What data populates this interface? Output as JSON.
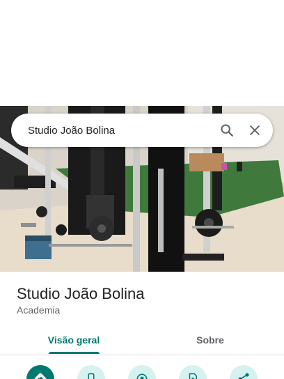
{
  "search": {
    "query": "Studio João Bolina"
  },
  "place": {
    "name": "Studio João Bolina",
    "category": "Academia"
  },
  "tabs": [
    {
      "label": "Visão geral",
      "selected": true
    },
    {
      "label": "Sobre",
      "selected": false
    }
  ],
  "actions": [
    {
      "icon": "directions-icon"
    },
    {
      "icon": "phone-icon"
    },
    {
      "icon": "location-icon"
    },
    {
      "icon": "save-icon"
    },
    {
      "icon": "share-icon"
    }
  ],
  "colors": {
    "accent": "#01796f",
    "accent_light": "#d6f2f0",
    "text_primary": "#202124",
    "text_secondary": "#5f6368"
  }
}
